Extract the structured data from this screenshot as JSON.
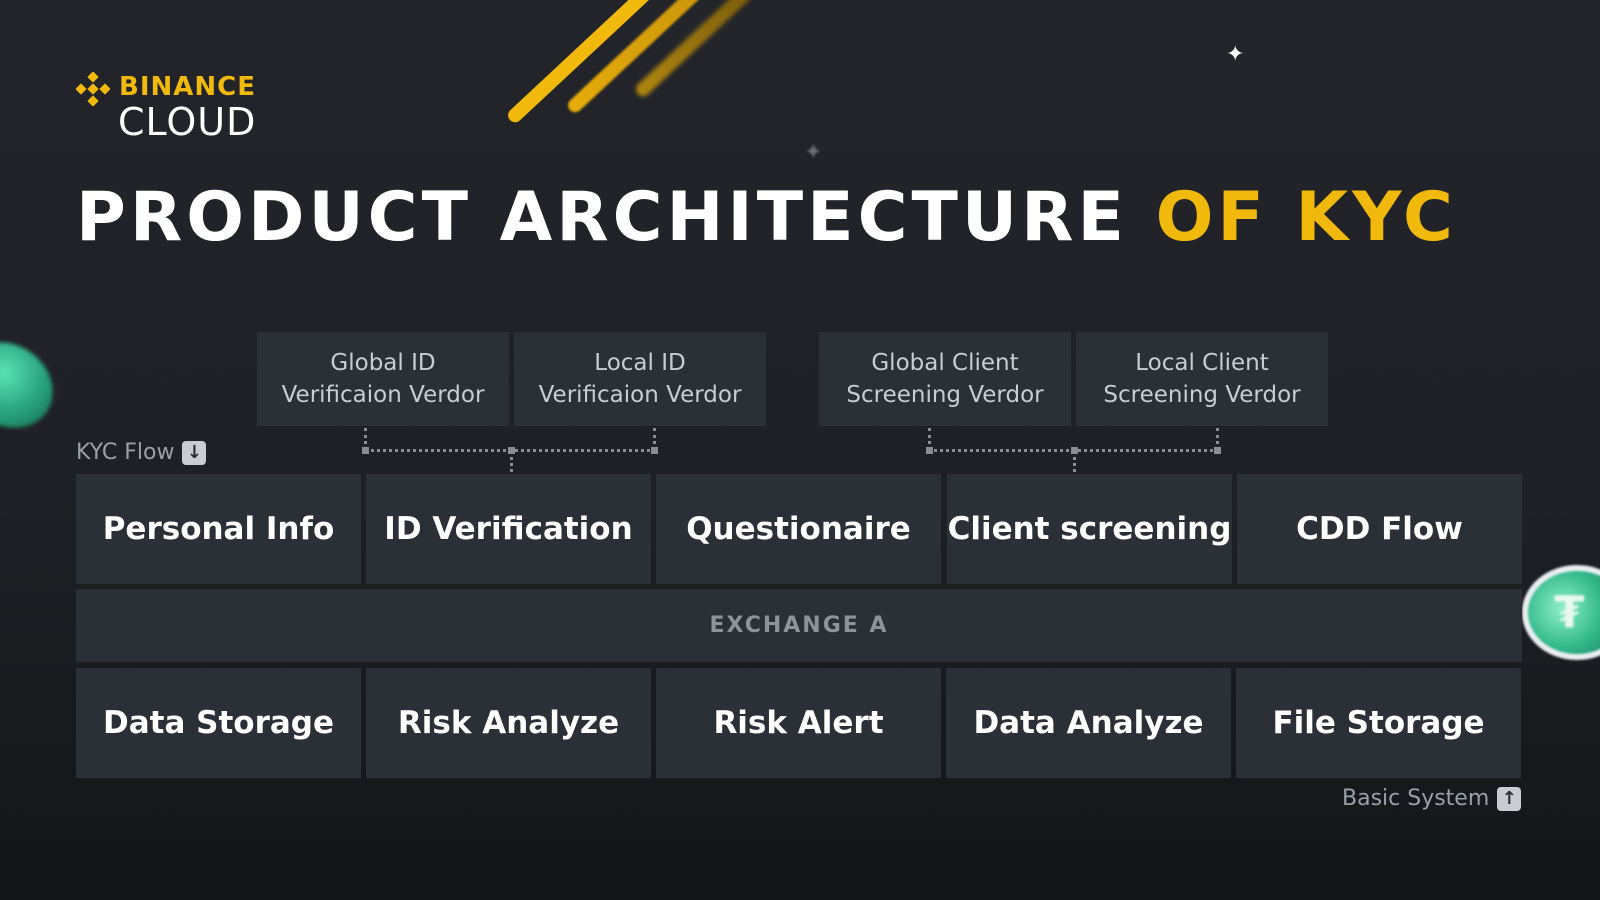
{
  "logo": {
    "top": "BINANCE",
    "bottom": "CLOUD"
  },
  "title": {
    "main": "PRODUCT ARCHITECTURE",
    "accent": "OF KYC"
  },
  "vendors": [
    {
      "line1": "Global ID",
      "line2": "Verificaion Verdor"
    },
    {
      "line1": "Local ID",
      "line2": "Verificaion Verdor"
    },
    {
      "line1": "Global Client",
      "line2": "Screening Verdor"
    },
    {
      "line1": "Local Client",
      "line2": "Screening Verdor"
    }
  ],
  "kyc_flow": {
    "label": "KYC Flow",
    "icon": "arrow-down-icon",
    "steps": [
      "Personal Info",
      "ID  Verification",
      "Questionaire",
      "Client screening",
      "CDD Flow"
    ]
  },
  "exchange": {
    "label": "EXCHANGE A"
  },
  "basic_system": {
    "label": "Basic System",
    "icon": "arrow-up-icon",
    "modules": [
      "Data Storage",
      "Risk Analyze",
      "Risk Alert",
      "Data Analyze",
      "File Storage"
    ]
  },
  "colors": {
    "accent": "#f0b90b",
    "box": "#2b2f36",
    "background": "#1e2025"
  }
}
